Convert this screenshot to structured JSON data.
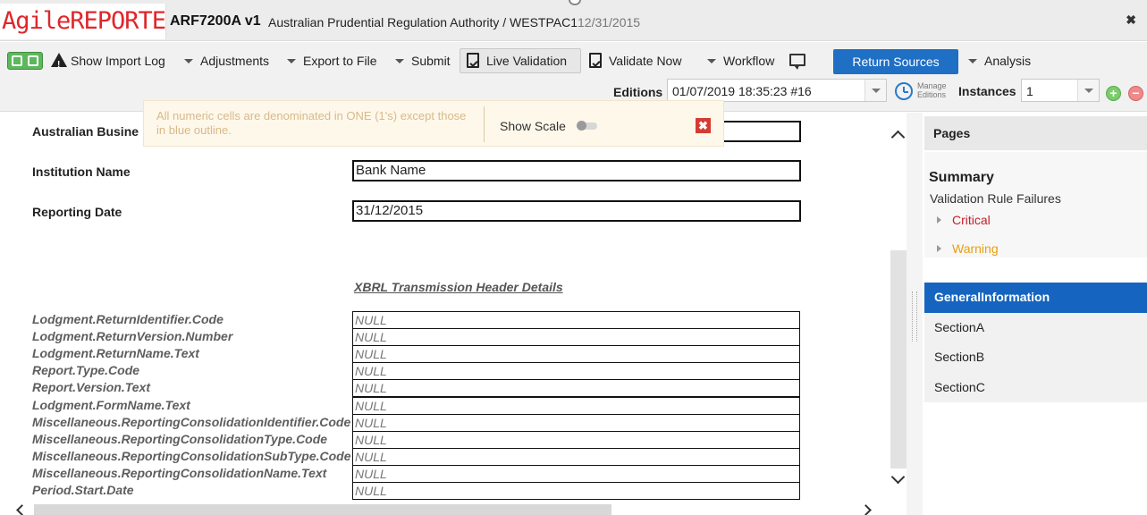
{
  "header": {
    "logo_text": "AgileREPORTER",
    "logo_mark": "®",
    "form_code": "ARF7200A v1",
    "entity": "Australian Prudential Regulation Authority / WESTPAC1",
    "period": "12/31/2015",
    "close_label": "✖"
  },
  "toolbar": {
    "show_import_log": "Show Import Log",
    "adjustments": "Adjustments",
    "export_to_file": "Export to File",
    "submit": "Submit",
    "live_validation": "Live Validation",
    "validate_now": "Validate Now",
    "workflow": "Workflow",
    "return_sources": "Return Sources",
    "analysis": "Analysis",
    "colors": {
      "return_sources": "#1f6fc5",
      "toggle_green": "#5cb85c"
    }
  },
  "editions": {
    "label": "Editions",
    "value": "01/07/2019 18:35:23 #16",
    "manage_line1": "Manage",
    "manage_line2": "Editions"
  },
  "instances": {
    "label": "Instances",
    "value": "1",
    "add": "+",
    "remove": "−"
  },
  "notification": {
    "text": "All numeric cells are denominated in ONE (1's) except those in blue outline.",
    "show_scale_label": "Show Scale",
    "close_label": "✖"
  },
  "form": {
    "australian_business_label": "Australian Busine",
    "institution_name_label": "Institution Name",
    "institution_name_value": "Bank Name",
    "reporting_date_label": "Reporting Date",
    "reporting_date_value": "31/12/2015",
    "section_header": "XBRL Transmission Header Details",
    "xbrl_rows": [
      {
        "label": "Lodgment.ReturnIdentifier.Code",
        "value": "NULL"
      },
      {
        "label": "Lodgment.ReturnVersion.Number",
        "value": "NULL"
      },
      {
        "label": "Lodgment.ReturnName.Text",
        "value": "NULL"
      },
      {
        "label": "Report.Type.Code",
        "value": "NULL"
      },
      {
        "label": "Report.Version.Text",
        "value": "NULL"
      },
      {
        "label": "Lodgment.FormName.Text",
        "value": "NULL"
      },
      {
        "label": "Miscellaneous.ReportingConsolidationIdentifier.Code",
        "value": "NULL"
      },
      {
        "label": "Miscellaneous.ReportingConsolidationType.Code",
        "value": "NULL"
      },
      {
        "label": "Miscellaneous.ReportingConsolidationSubType.Code",
        "value": "NULL"
      },
      {
        "label": "Miscellaneous.ReportingConsolidationName.Text",
        "value": "NULL"
      },
      {
        "label": "Period.Start.Date",
        "value": "NULL"
      }
    ]
  },
  "sidebar": {
    "pages_title": "Pages",
    "summary_title": "Summary",
    "validation_failures": "Validation Rule Failures",
    "critical": "Critical",
    "warning": "Warning",
    "colors": {
      "critical": "#c4202a",
      "warning": "#e5a013",
      "active": "#1565c0"
    },
    "pages": [
      {
        "label": "GeneralInformation",
        "active": true
      },
      {
        "label": "SectionA",
        "active": false
      },
      {
        "label": "SectionB",
        "active": false
      },
      {
        "label": "SectionC",
        "active": false
      }
    ]
  }
}
